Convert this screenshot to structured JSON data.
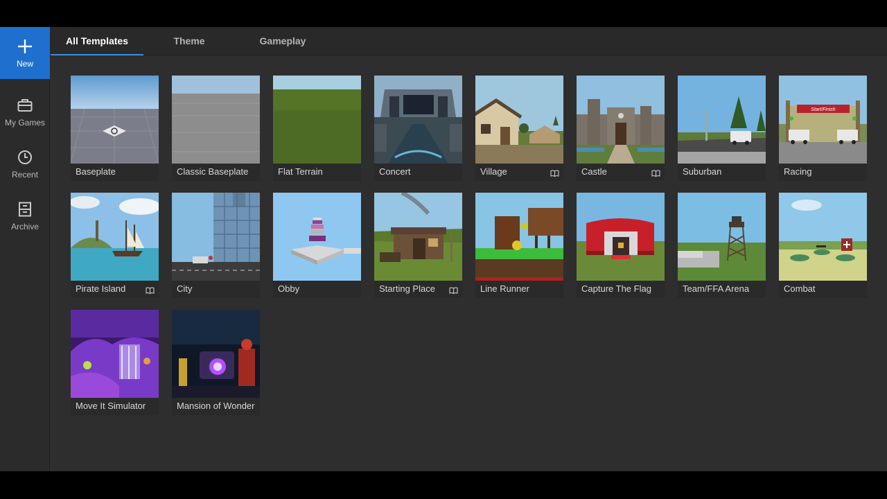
{
  "sidebar": {
    "items": [
      {
        "label": "New",
        "icon": "plus-icon",
        "active": true
      },
      {
        "label": "My Games",
        "icon": "briefcase-icon",
        "active": false
      },
      {
        "label": "Recent",
        "icon": "clock-icon",
        "active": false
      },
      {
        "label": "Archive",
        "icon": "archive-icon",
        "active": false
      }
    ]
  },
  "tabs": [
    {
      "label": "All Templates",
      "active": true
    },
    {
      "label": "Theme",
      "active": false
    },
    {
      "label": "Gameplay",
      "active": false
    }
  ],
  "templates": [
    {
      "name": "Baseplate",
      "tutorial": false
    },
    {
      "name": "Classic Baseplate",
      "tutorial": false
    },
    {
      "name": "Flat Terrain",
      "tutorial": false
    },
    {
      "name": "Concert",
      "tutorial": false
    },
    {
      "name": "Village",
      "tutorial": true
    },
    {
      "name": "Castle",
      "tutorial": true
    },
    {
      "name": "Suburban",
      "tutorial": false
    },
    {
      "name": "Racing",
      "tutorial": false
    },
    {
      "name": "Pirate Island",
      "tutorial": true
    },
    {
      "name": "City",
      "tutorial": false
    },
    {
      "name": "Obby",
      "tutorial": false
    },
    {
      "name": "Starting Place",
      "tutorial": true
    },
    {
      "name": "Line Runner",
      "tutorial": false
    },
    {
      "name": "Capture The Flag",
      "tutorial": false
    },
    {
      "name": "Team/FFA Arena",
      "tutorial": false
    },
    {
      "name": "Combat",
      "tutorial": false
    },
    {
      "name": "Move It Simulator",
      "tutorial": false
    },
    {
      "name": "Mansion of Wonder",
      "tutorial": false
    }
  ],
  "thumb_text": {
    "racing_banner": "Start/Finish"
  },
  "colors": {
    "accent": "#1f6fcf",
    "tab_underline": "#3a8ee6",
    "background": "#2e2e2e"
  }
}
